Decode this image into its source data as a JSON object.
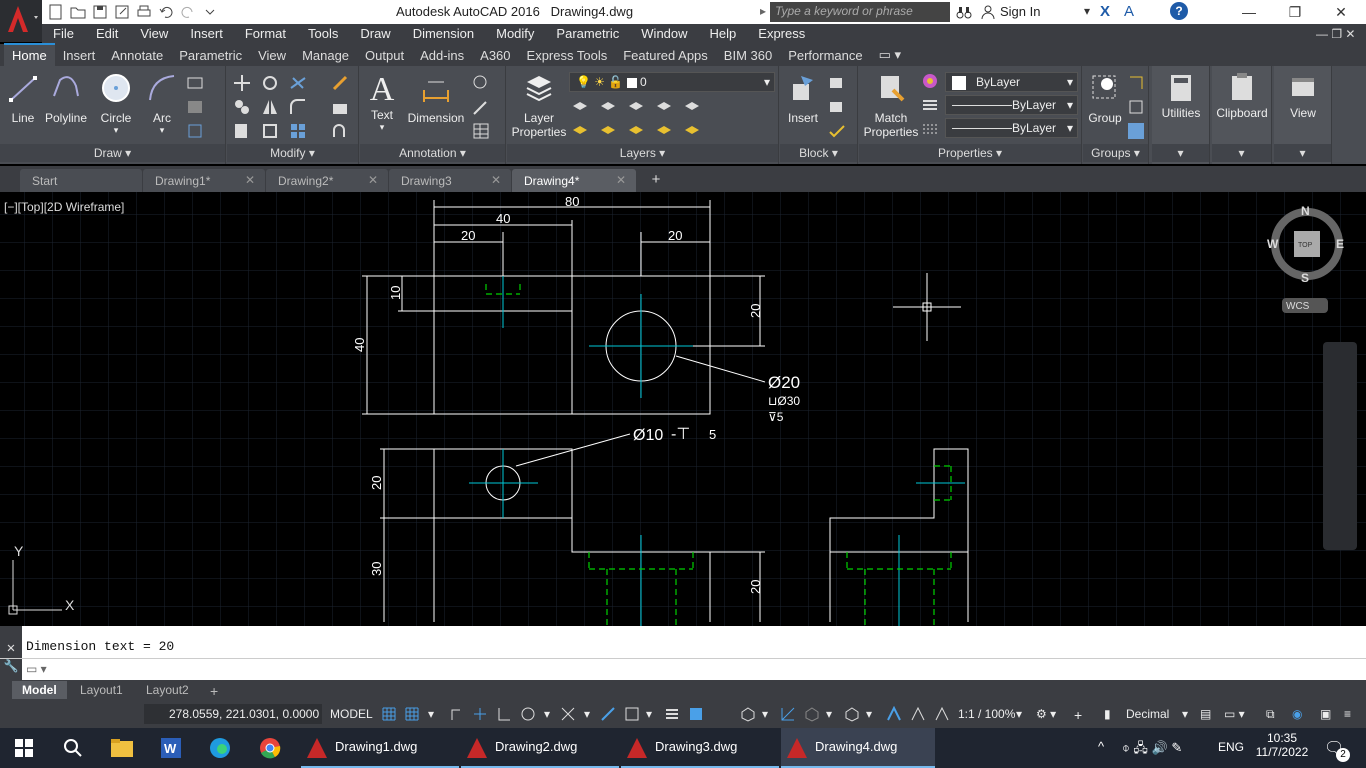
{
  "titlebar": {
    "app_title": "Autodesk AutoCAD 2016",
    "doc_title": "Drawing4.dwg",
    "search_placeholder": "Type a keyword or phrase",
    "signin": "Sign In"
  },
  "menu": [
    "File",
    "Edit",
    "View",
    "Insert",
    "Format",
    "Tools",
    "Draw",
    "Dimension",
    "Modify",
    "Parametric",
    "Window",
    "Help",
    "Express"
  ],
  "ribbon_tabs": [
    "Home",
    "Insert",
    "Annotate",
    "Parametric",
    "View",
    "Manage",
    "Output",
    "Add-ins",
    "A360",
    "Express Tools",
    "Featured Apps",
    "BIM 360",
    "Performance"
  ],
  "ribbon": {
    "draw": {
      "label": "Draw",
      "line": "Line",
      "polyline": "Polyline",
      "circle": "Circle",
      "arc": "Arc"
    },
    "modify": {
      "label": "Modify"
    },
    "annotation": {
      "label": "Annotation",
      "text": "Text",
      "dimension": "Dimension"
    },
    "layers": {
      "label": "Layers",
      "layer_properties": "Layer\nProperties",
      "layer_value": "0"
    },
    "block": {
      "label": "Block",
      "insert": "Insert"
    },
    "properties": {
      "label": "Properties",
      "match": "Match\nProperties",
      "color": "ByLayer",
      "linetype": "ByLayer",
      "lineweight": "ByLayer"
    },
    "groups": {
      "label": "Groups",
      "group": "Group"
    },
    "utilities": "Utilities",
    "clipboard": "Clipboard",
    "view": "View"
  },
  "doc_tabs": [
    {
      "label": "Start",
      "active": false,
      "closable": false
    },
    {
      "label": "Drawing1*",
      "active": false,
      "closable": true
    },
    {
      "label": "Drawing2*",
      "active": false,
      "closable": true
    },
    {
      "label": "Drawing3",
      "active": false,
      "closable": true
    },
    {
      "label": "Drawing4*",
      "active": true,
      "closable": true
    }
  ],
  "viewport_label": "[−][Top][2D Wireframe]",
  "viewcube": {
    "n": "N",
    "s": "S",
    "e": "E",
    "w": "W",
    "top": "TOP",
    "wcs": "WCS"
  },
  "ucs": {
    "x": "X",
    "y": "Y"
  },
  "drawing_text": {
    "d80": "80",
    "d40": "40",
    "d20a": "20",
    "d20b": "20",
    "d10": "10",
    "d40v": "40",
    "d20r": "20",
    "hole_dia": "Ø20",
    "hole_cb": "⊔Ø30",
    "hole_depth": "⊽5",
    "small_hole": "Ø10",
    "small_depth": "5",
    "d20f": "20",
    "d30f": "30",
    "d20fr": "20"
  },
  "command": {
    "history": "Dimension text = 20",
    "prompt": ""
  },
  "layout_tabs": [
    "Model",
    "Layout1",
    "Layout2"
  ],
  "status": {
    "coords": "278.0559, 221.0301, 0.0000",
    "model": "MODEL",
    "scale": "1:1 / 100%",
    "units": "Decimal"
  },
  "taskbar": {
    "apps": [
      "Drawing1.dwg",
      "Drawing2.dwg",
      "Drawing3.dwg",
      "Drawing4.dwg"
    ],
    "lang": "ENG",
    "time": "10:35",
    "date": "11/7/2022",
    "notif": "2"
  }
}
